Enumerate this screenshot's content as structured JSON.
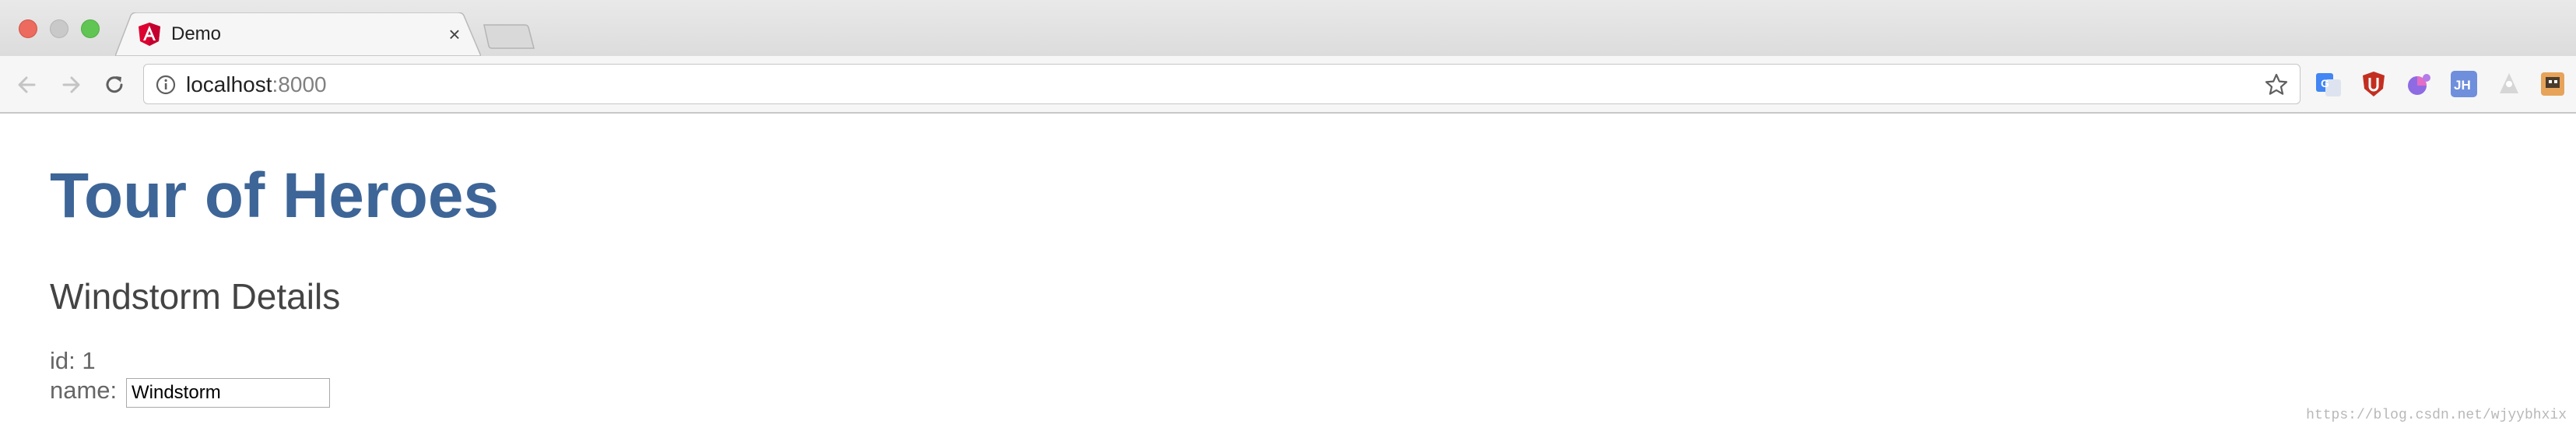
{
  "browser": {
    "tab": {
      "title": "Demo",
      "close_glyph": "×",
      "favicon": "angular-logo-icon"
    },
    "address_bar": {
      "host": "localhost",
      "port": ":8000"
    },
    "colors": {
      "close": "#ed6a5e",
      "minimize": "#c9c9c9",
      "maximize": "#61c554"
    },
    "extensions": [
      "google-translate-icon",
      "ublock-icon",
      "color-picker-icon",
      "jh-extension-icon",
      "user-extension-icon",
      "profile-extension-icon"
    ]
  },
  "page": {
    "title": "Tour of Heroes",
    "detail_heading": "Windstorm Details",
    "id_label": "id:",
    "id_value": "1",
    "name_label": "name:",
    "name_value": "Windstorm",
    "title_color": "#3d6597"
  },
  "watermark": "https://blog.csdn.net/wjyybhxix"
}
